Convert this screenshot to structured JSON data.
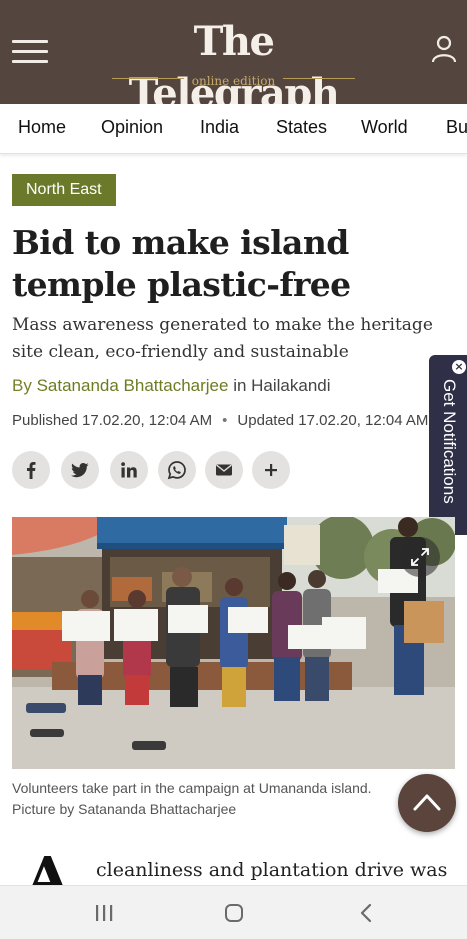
{
  "masthead": {
    "logo_title": "The Telegraph",
    "logo_edition": "online edition",
    "menu_icon": "hamburger-menu-icon",
    "user_icon": "user-icon",
    "background_color": "#54463f"
  },
  "nav": {
    "items": [
      "Home",
      "Opinion",
      "India",
      "States",
      "World",
      "Bu"
    ]
  },
  "article": {
    "category": "North East",
    "category_color": "#6b7a2a",
    "headline": "Bid to make island temple plastic-free",
    "subheadline": "Mass awareness generated to make the heritage site clean, eco-friendly and sustainable",
    "byline_prefix": "By",
    "author": "Satananda Bhattacharjee",
    "location": "in Hailakandi",
    "published": "Published 17.02.20, 12:04 AM",
    "separator": "•",
    "updated": "Updated 17.02.20, 12:04 AM",
    "share_icons": [
      "facebook-icon",
      "twitter-icon",
      "linkedin-icon",
      "whatsapp-icon",
      "email-icon",
      "plus-icon"
    ],
    "photo_caption_line1": "Volunteers take part in the campaign at Umananda island.",
    "photo_caption_line2": "Picture by Satananda Bhattacharjee",
    "dropcap": "A",
    "body_first_line": "cleanliness and plantation drive was"
  },
  "notification_tab": {
    "label": "Get Notifications",
    "close_glyph": "×",
    "color": "#2f2f48"
  },
  "back_to_top_icon": "chevron-up-icon",
  "system_nav": {
    "icons": [
      "recent-apps-icon",
      "home-icon",
      "back-icon"
    ]
  }
}
